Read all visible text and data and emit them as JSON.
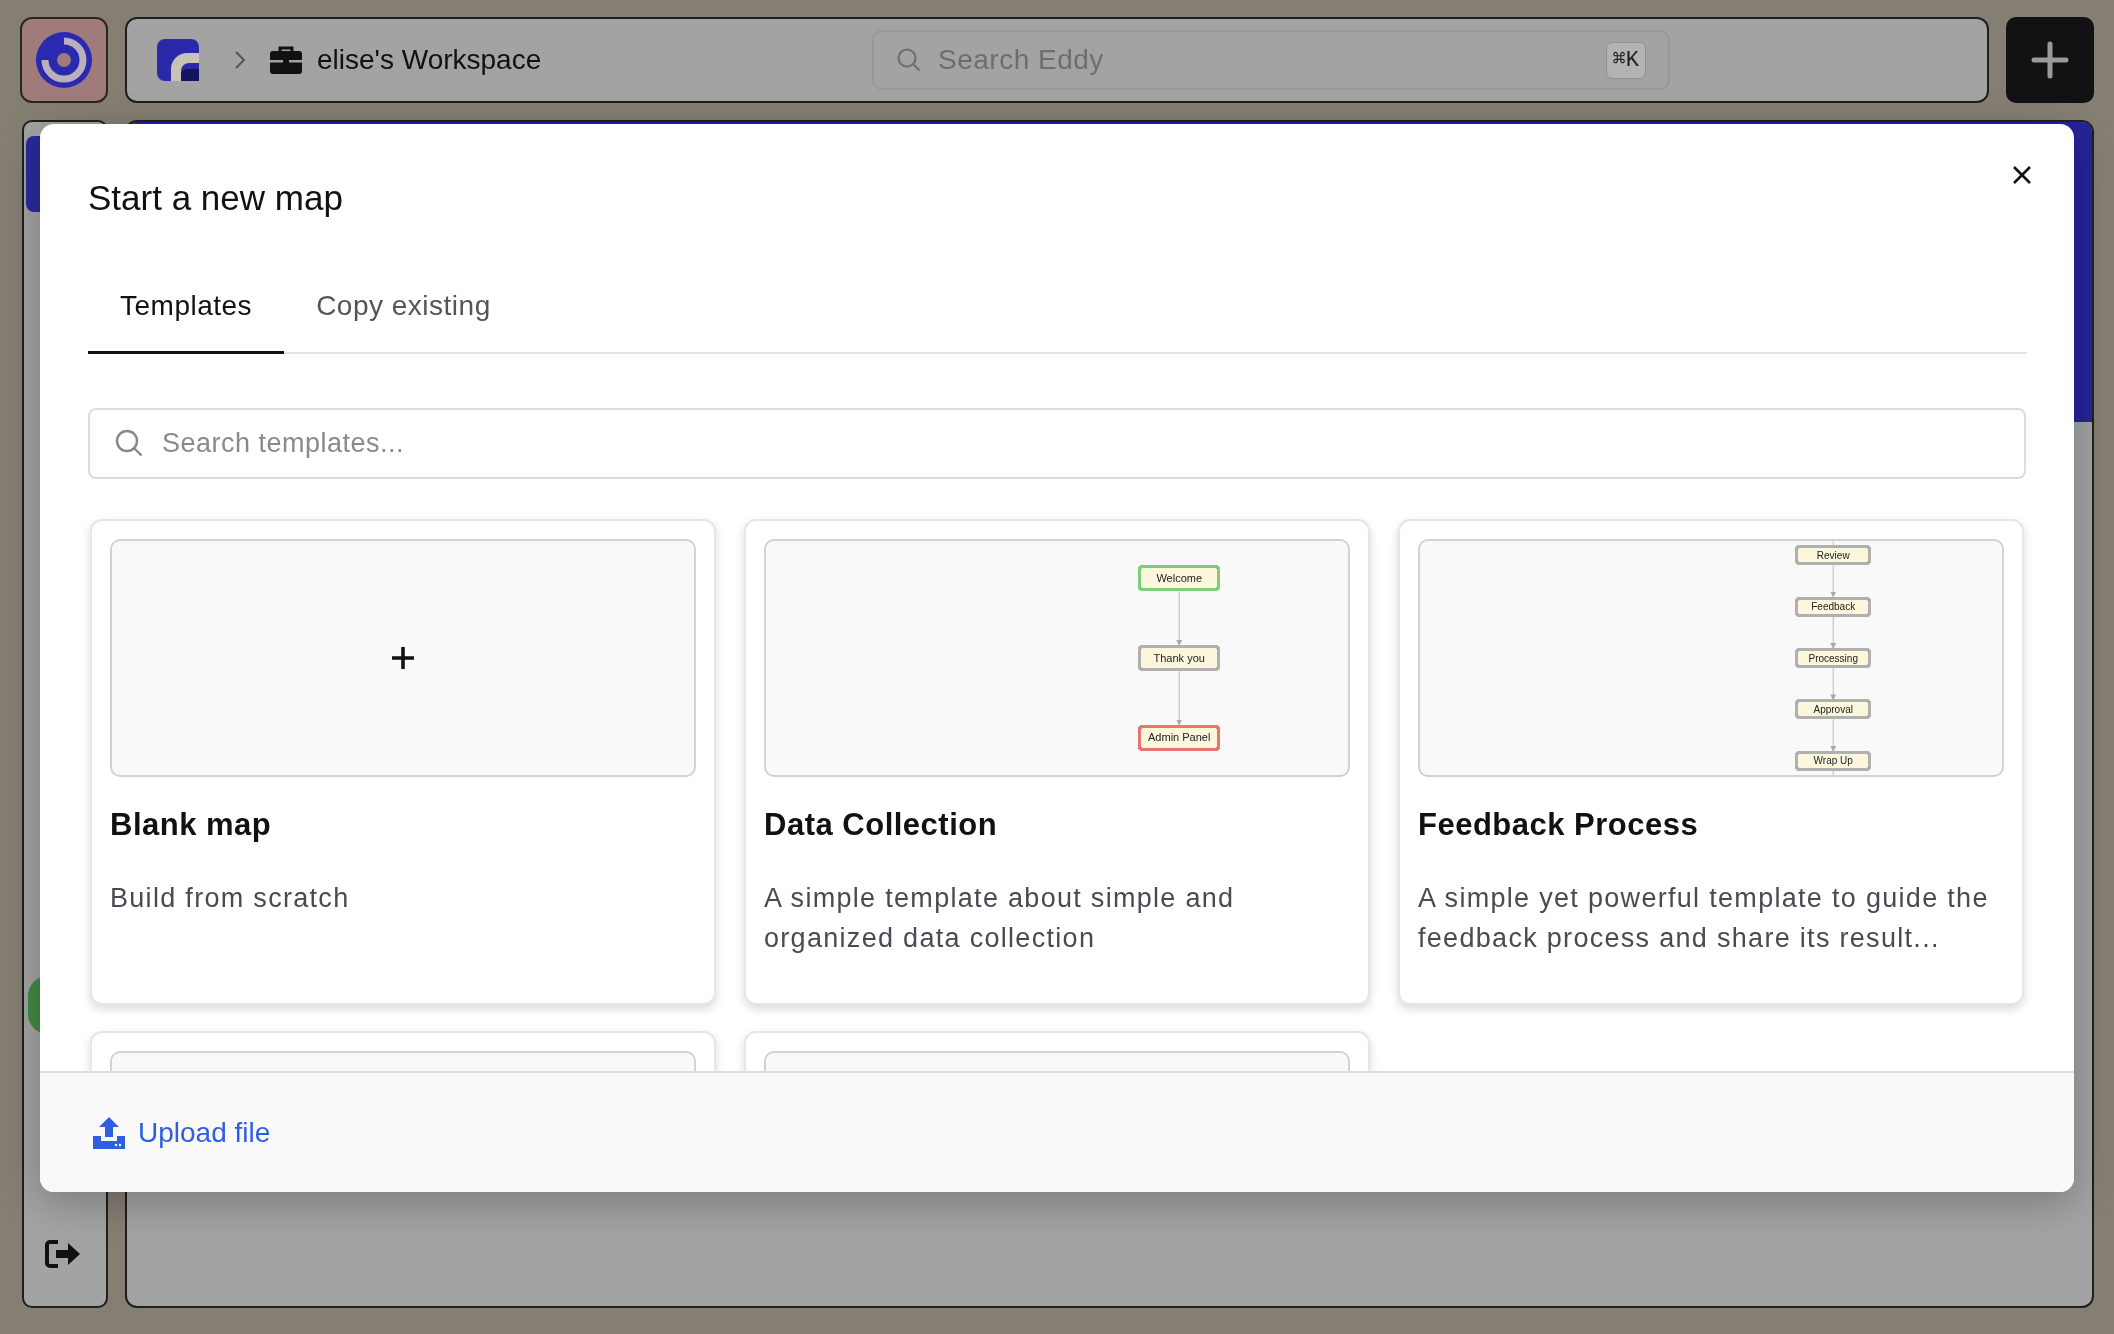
{
  "breadcrumb": {
    "workspace": "elise's Workspace"
  },
  "search": {
    "placeholder": "Search Eddy",
    "shortcut": "⌘K"
  },
  "dialog": {
    "title": "Start a new map",
    "tabs": [
      {
        "label": "Templates",
        "selected": true
      },
      {
        "label": "Copy existing",
        "selected": false
      }
    ],
    "search": {
      "placeholder": "Search templates..."
    },
    "templates": [
      {
        "kind": "blank",
        "title": "Blank map",
        "description": "Build from scratch"
      },
      {
        "kind": "flow",
        "title": "Data Collection",
        "description": "A simple template about simple and organized data collection",
        "nodes": [
          {
            "label": "Welcome",
            "color": "#7fcf7a"
          },
          {
            "label": "Thank you",
            "color": "#b0b0b0"
          },
          {
            "label": "Admin Panel",
            "color": "#e8766d"
          }
        ]
      },
      {
        "kind": "flow",
        "title": "Feedback Process",
        "description": "A simple yet powerful template to guide the feedback process and share its result...",
        "nodes": [
          {
            "label": "Review",
            "color": "#b0b0b0"
          },
          {
            "label": "Feedback",
            "color": "#b0b0b0"
          },
          {
            "label": "Processing",
            "color": "#b0b0b0"
          },
          {
            "label": "Approval",
            "color": "#b0b0b0"
          },
          {
            "label": "Wrap Up",
            "color": "#b0b0b0"
          }
        ]
      },
      {
        "kind": "partial"
      },
      {
        "kind": "partial"
      }
    ],
    "footer": {
      "upload_label": "Upload file"
    }
  }
}
